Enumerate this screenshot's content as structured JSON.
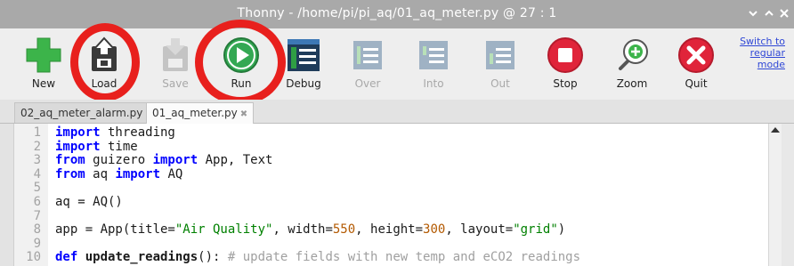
{
  "window": {
    "title": "Thonny  -  /home/pi/pi_aq/01_aq_meter.py  @  27 : 1"
  },
  "toolbar": {
    "buttons": [
      {
        "label": "New",
        "icon": "new-file-icon",
        "enabled": true
      },
      {
        "label": "Load",
        "icon": "load-file-icon",
        "enabled": true
      },
      {
        "label": "Save",
        "icon": "save-file-icon",
        "enabled": false
      },
      {
        "label": "Run",
        "icon": "run-icon",
        "enabled": true
      },
      {
        "label": "Debug",
        "icon": "debug-icon",
        "enabled": true
      },
      {
        "label": "Over",
        "icon": "step-over-icon",
        "enabled": false
      },
      {
        "label": "Into",
        "icon": "step-into-icon",
        "enabled": false
      },
      {
        "label": "Out",
        "icon": "step-out-icon",
        "enabled": false
      },
      {
        "label": "Stop",
        "icon": "stop-icon",
        "enabled": true
      },
      {
        "label": "Zoom",
        "icon": "zoom-icon",
        "enabled": true
      },
      {
        "label": "Quit",
        "icon": "quit-icon",
        "enabled": true
      }
    ],
    "switch_mode_line1": "Switch to",
    "switch_mode_line2": "regular",
    "switch_mode_line3": "mode",
    "highlighted": [
      "Load",
      "Run"
    ]
  },
  "tabs": [
    {
      "label": "02_aq_meter_alarm.py",
      "active": false
    },
    {
      "label": "01_aq_meter.py",
      "active": true
    }
  ],
  "editor": {
    "line_numbers": [
      "1",
      "2",
      "3",
      "4",
      "5",
      "6",
      "7",
      "8",
      "9",
      "10"
    ],
    "lines": [
      "import threading",
      "import time",
      "from guizero import App, Text",
      "from aq import AQ",
      "",
      "aq = AQ()",
      "",
      "app = App(title=\"Air Quality\", width=550, height=300, layout=\"grid\")",
      "",
      "def update_readings(): # update fields with new temp and eCO2 readings"
    ]
  },
  "colors": {
    "titlebar": "#a9a9a9",
    "highlight_circle": "#e8201d",
    "keyword": "#0000ff",
    "string": "#008000",
    "link": "#2f47d6"
  }
}
